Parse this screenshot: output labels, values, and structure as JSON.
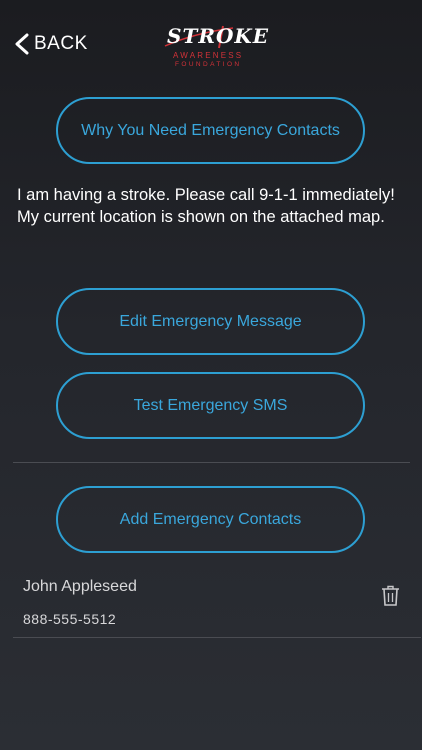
{
  "header": {
    "back_label": "BACK",
    "logo": {
      "word": "STROKE",
      "line1": "AWARENESS",
      "line2": "FOUNDATION"
    }
  },
  "buttons": {
    "why_contacts": "Why You Need Emergency Contacts",
    "edit_message": "Edit Emergency Message",
    "test_sms": "Test Emergency SMS",
    "add_contacts": "Add Emergency Contacts"
  },
  "emergency_message": "I am having a stroke. Please call 9-1-1 immediately! My current location is shown on the attached map.",
  "contacts": [
    {
      "name": "John Appleseed",
      "phone": "888-555-5512"
    }
  ],
  "colors": {
    "accent": "#2d9fd2",
    "brand_red": "#d23238",
    "background": "#1f2024"
  },
  "icons": {
    "back": "chevron-left-icon",
    "delete": "trash-icon"
  }
}
